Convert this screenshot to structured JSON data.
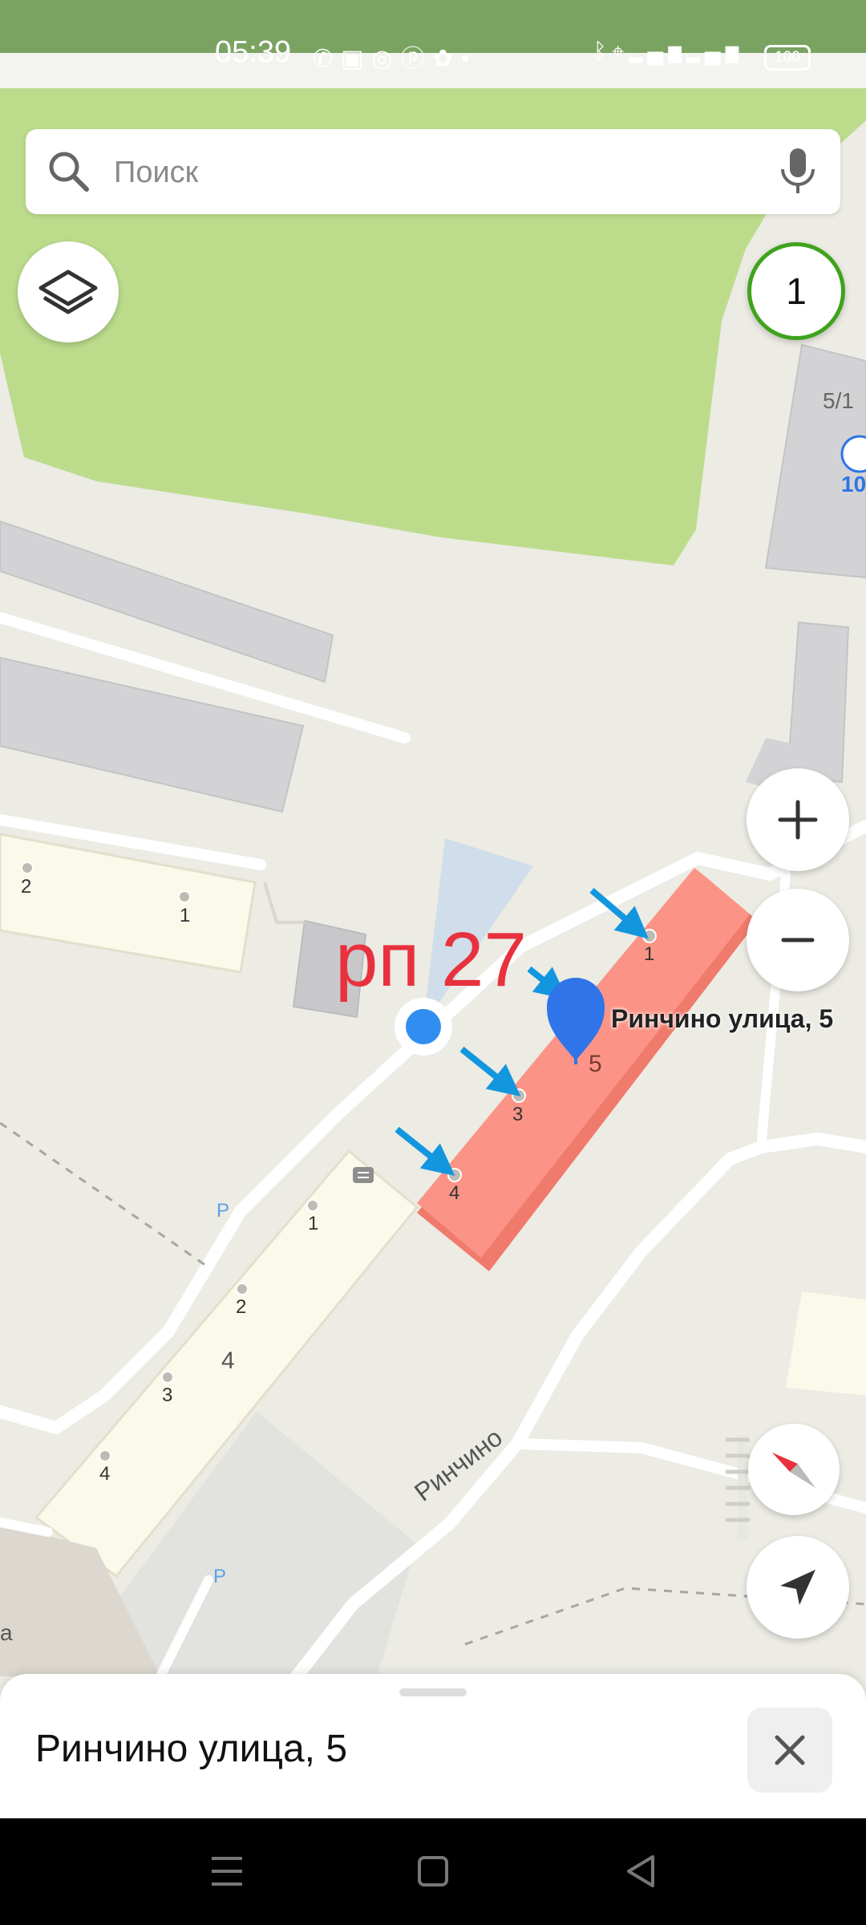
{
  "status_bar": {
    "time": "05:39",
    "left_icons": [
      "viber-icon",
      "app-icon",
      "search-app-icon",
      "pinterest-icon",
      "app-icon",
      "dot-icon"
    ],
    "right_icons": [
      "bluetooth-icon",
      "location-icon",
      "signal-4g-icon",
      "signal-icon"
    ],
    "battery": "100"
  },
  "search": {
    "placeholder": "Поиск",
    "icon": "search-icon",
    "mic_icon": "microphone-icon"
  },
  "controls": {
    "layers_icon": "layers-icon",
    "counter": "1",
    "zoom_in_icon": "plus-icon",
    "zoom_out_icon": "minus-icon",
    "compass_icon": "compass-icon",
    "locate_icon": "navigation-arrow-icon"
  },
  "map": {
    "annotation": "рп 27",
    "selected_address": "Ринчино улица, 5",
    "street_label": "Ринчино",
    "house_number_main": "5",
    "building_label_right": "5/1",
    "poi_number": "10",
    "entrances_selected": [
      "1",
      "3",
      "4"
    ],
    "entrances_left_building": [
      "2",
      "1"
    ],
    "entrances_bottom_building": [
      "1",
      "2",
      "3",
      "4"
    ],
    "bottom_building_number": "4",
    "parking_label": "P",
    "edge_label": "а",
    "colors": {
      "park": "#bcdc8c",
      "selected_building": "#fb9486",
      "marker": "#2f74e8",
      "arrow": "#1297df",
      "annotation": "#e8313e"
    }
  },
  "bottom_sheet": {
    "title": "Ринчино улица, 5",
    "close_icon": "close-icon"
  },
  "nav_bar": {
    "icons": [
      "menu-icon",
      "home-icon",
      "back-icon"
    ]
  }
}
